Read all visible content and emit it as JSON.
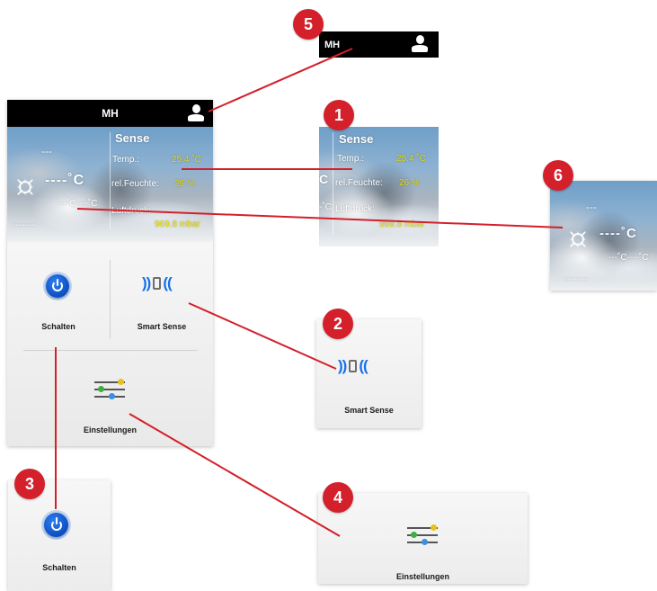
{
  "header": {
    "user_initials": "MH"
  },
  "weather": {
    "sensor_title": "Sense",
    "forecast_dash": "---",
    "temp_display": "----˚C",
    "minmax_display": "---˚C----˚C",
    "bottom_dashes": "--------",
    "temp_label": "Temp.:",
    "temp_value": "25.4 ˚C",
    "humidity_label": "rel.Feuchte:",
    "humidity_value": "26 %",
    "pressure_label": "Luftdruck:",
    "pressure_value": "969.8 mbar"
  },
  "menu": {
    "switch_label": "Schalten",
    "smart_sense_label": "Smart Sense",
    "settings_label": "Einstellungen"
  },
  "callouts": {
    "c1": "1",
    "c2": "2",
    "c3": "3",
    "c4": "4",
    "c5": "5",
    "c6": "6"
  },
  "colors": {
    "callout_red": "#d3202a",
    "accent_blue": "#1670e8",
    "value_yellow": "#e3d800",
    "header_black": "#000000"
  }
}
